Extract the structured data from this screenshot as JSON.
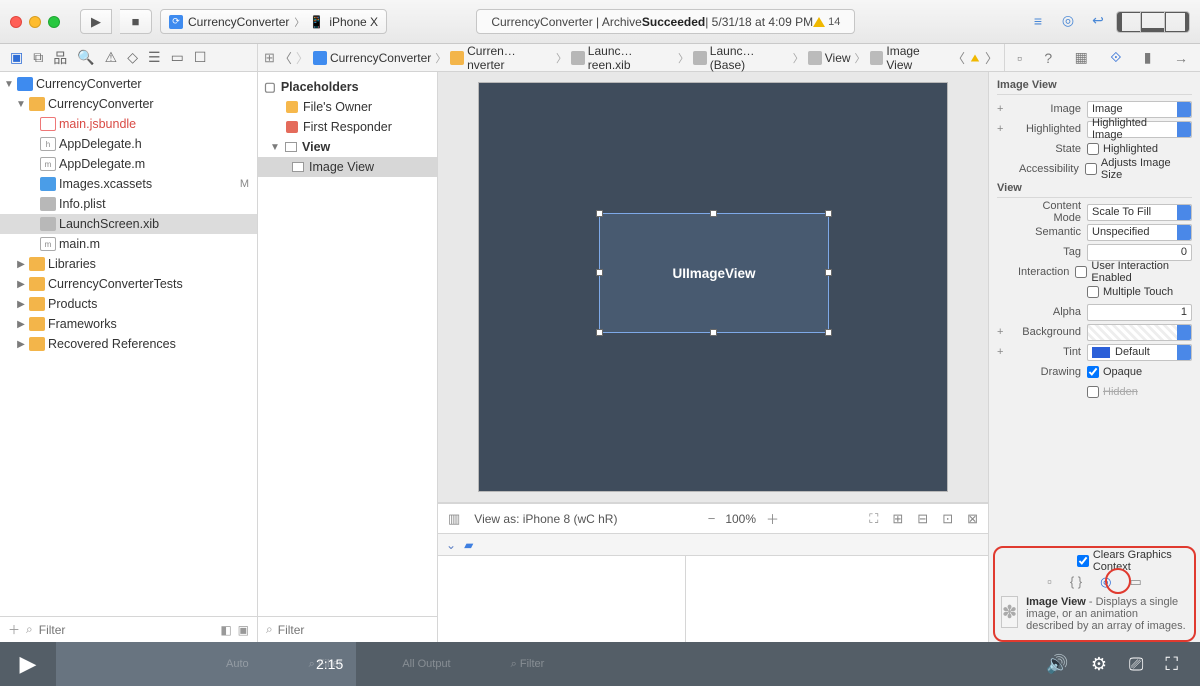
{
  "toolbar": {
    "scheme_app": "CurrencyConverter",
    "scheme_device": "iPhone X",
    "status_prefix": "CurrencyConverter  |  Archive ",
    "status_bold": "Succeeded",
    "status_suffix": "  |  5/31/18 at 4:09 PM",
    "warnings": "14"
  },
  "jumpbar": {
    "segs": [
      "CurrencyConverter",
      "Curren…nverter",
      "Launc…reen.xib",
      "Launc…(Base)",
      "View",
      "Image View"
    ]
  },
  "navigator": {
    "root": "CurrencyConverter",
    "group": "CurrencyConverter",
    "files": {
      "jsbundle": "main.jsbundle",
      "appdel_h": "AppDelegate.h",
      "appdel_m": "AppDelegate.m",
      "xcassets": "Images.xcassets",
      "xcassets_status": "M",
      "plist": "Info.plist",
      "launch": "LaunchScreen.xib",
      "mainm": "main.m"
    },
    "folders": [
      "Libraries",
      "CurrencyConverterTests",
      "Products",
      "Frameworks",
      "Recovered References"
    ],
    "filter_placeholder": "Filter"
  },
  "outline": {
    "placeholders": "Placeholders",
    "files_owner": "File's Owner",
    "first_responder": "First Responder",
    "view": "View",
    "image_view": "Image View",
    "filter_placeholder": "Filter"
  },
  "canvas": {
    "selected_label": "UIImageView",
    "view_as": "View as: iPhone 8 (wC hR)",
    "zoom": "100%"
  },
  "inspector": {
    "section_image_view": "Image View",
    "image_lbl": "Image",
    "image_ph": "Image",
    "highlighted_lbl": "Highlighted",
    "highlighted_ph": "Highlighted Image",
    "state_lbl": "State",
    "state_chk": "Highlighted",
    "acc_lbl": "Accessibility",
    "acc_chk": "Adjusts Image Size",
    "section_view": "View",
    "content_mode_lbl": "Content Mode",
    "content_mode": "Scale To Fill",
    "semantic_lbl": "Semantic",
    "semantic": "Unspecified",
    "tag_lbl": "Tag",
    "tag": "0",
    "interaction_lbl": "Interaction",
    "uie": "User Interaction Enabled",
    "mt": "Multiple Touch",
    "alpha_lbl": "Alpha",
    "alpha": "1",
    "background_lbl": "Background",
    "tint_lbl": "Tint",
    "tint": "Default",
    "drawing_lbl": "Drawing",
    "opaque": "Opaque",
    "hidden": "Hidden",
    "clears": "Clears Graphics Context",
    "lib_title": "Image View",
    "lib_desc": " - Displays a single image, or an animation described by an array of images."
  },
  "debug": {
    "auto": "Auto",
    "filter": "Filter",
    "all_output": "All Output"
  },
  "video": {
    "time": "2:15"
  }
}
